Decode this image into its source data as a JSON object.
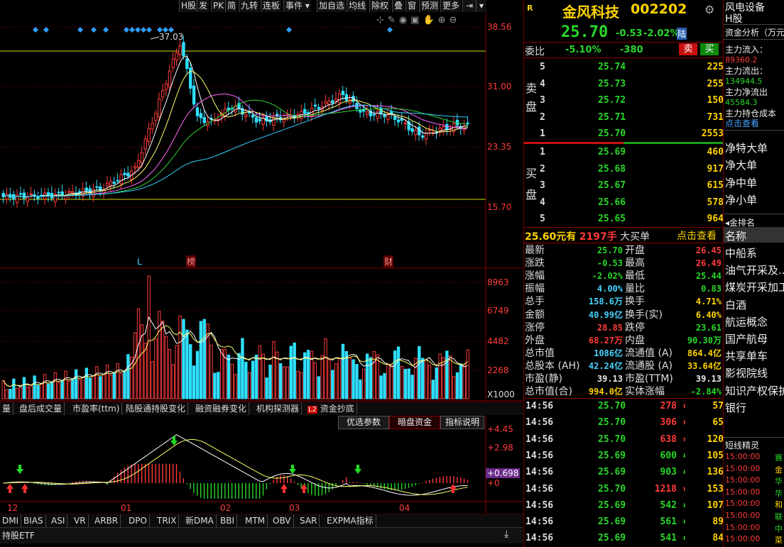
{
  "toolbar": {
    "left_buttons": [
      "H股",
      "发",
      "PK",
      "简",
      "九转",
      "连板",
      "事件"
    ],
    "right_buttons": [
      "加自选",
      "均线",
      "除权",
      "叠",
      "窗",
      "预测",
      "更多"
    ]
  },
  "price_axis": [
    "38.56",
    "31.00",
    "23.35",
    "15.70"
  ],
  "high_marker": "37.03",
  "event_markers": [
    "L",
    "榜",
    "财"
  ],
  "volume_axis": [
    "8963",
    "6749",
    "4482",
    "2268",
    "X1000"
  ],
  "indicator_tabs": [
    "量",
    "盘后成交量",
    "市盈率(ttm)",
    "陆股通持股变化",
    "融资融券变化",
    "机构探测器",
    "资金抄底"
  ],
  "indicator_tab_l2_badge": "L2",
  "indicator_buttons": [
    "优选参数",
    "暗盘资金",
    "指标说明"
  ],
  "macd_axis": [
    "+4.45",
    "+2.98",
    "+0.698",
    "+0"
  ],
  "date_axis": [
    "12",
    "01",
    "02",
    "03",
    "04"
  ],
  "bottom_tabs": [
    "DMI",
    "BIAS",
    "ASI",
    "VR",
    "ARBR",
    "DPO",
    "TRIX",
    "新DMA",
    "BBI",
    "MTM",
    "OBV",
    "SAR",
    "EXPMA指标"
  ],
  "bottom_label": "持股ETF",
  "quote": {
    "r_badge": "R",
    "name": "金风科技",
    "code": "002202",
    "price": "25.70",
    "change": "-0.53",
    "change_pct": "-2.02%",
    "lu_badge": "陆",
    "weibi_label": "委比",
    "weibi_pct": "-5.10%",
    "weicha": "-380",
    "buy_btn": "买",
    "sell_btn": "卖",
    "sell_label": "卖盘",
    "buy_label": "买盘",
    "asks": [
      {
        "level": "5",
        "price": "25.74",
        "vol": "225"
      },
      {
        "level": "4",
        "price": "25.73",
        "vol": "255"
      },
      {
        "level": "3",
        "price": "25.72",
        "vol": "150"
      },
      {
        "level": "2",
        "price": "25.71",
        "vol": "731"
      },
      {
        "level": "1",
        "price": "25.70",
        "vol": "2553"
      }
    ],
    "bids": [
      {
        "level": "1",
        "price": "25.69",
        "vol": "460"
      },
      {
        "level": "2",
        "price": "25.68",
        "vol": "917"
      },
      {
        "level": "3",
        "price": "25.67",
        "vol": "615"
      },
      {
        "level": "4",
        "price": "25.66",
        "vol": "578"
      },
      {
        "level": "5",
        "price": "25.65",
        "vol": "964"
      }
    ],
    "big_order_price": "25.60元有",
    "big_order_vol": "2197手",
    "big_order_label": "大买单",
    "big_order_link": "点击查看",
    "stats": [
      {
        "l1": "最新",
        "v1": "25.70",
        "c1": "grn",
        "l2": "开盘",
        "v2": "26.45",
        "c2": "red"
      },
      {
        "l1": "涨跌",
        "v1": "-0.53",
        "c1": "grn",
        "l2": "最高",
        "v2": "26.49",
        "c2": "red"
      },
      {
        "l1": "涨幅",
        "v1": "-2.02%",
        "c1": "grn",
        "l2": "最低",
        "v2": "25.44",
        "c2": "grn"
      },
      {
        "l1": "振幅",
        "v1": "4.00%",
        "c1": "cyan",
        "l2": "量比",
        "v2": "0.83",
        "c2": "grn"
      },
      {
        "l1": "总手",
        "v1": "158.6万",
        "c1": "cyan",
        "l2": "换手",
        "v2": "4.71%",
        "c2": "yel"
      },
      {
        "l1": "金额",
        "v1": "40.99亿",
        "c1": "cyan",
        "l2": "换手(实)",
        "v2": "6.40%",
        "c2": "yel"
      },
      {
        "l1": "涨停",
        "v1": "28.85",
        "c1": "red",
        "l2": "跌停",
        "v2": "23.61",
        "c2": "grn"
      },
      {
        "l1": "外盘",
        "v1": "68.27万",
        "c1": "red",
        "l2": "内盘",
        "v2": "90.30万",
        "c2": "grn"
      },
      {
        "l1": "总市值",
        "v1": "1086亿",
        "c1": "cyan",
        "l2": "流通值 (A)",
        "v2": "864.4亿",
        "c2": "yel"
      },
      {
        "l1": "总股本 (AH)",
        "v1": "42.24亿",
        "c1": "cyan",
        "l2": "流通股 (A)",
        "v2": "33.64亿",
        "c2": "yel"
      },
      {
        "l1": "市盈(静)",
        "v1": "39.13",
        "c1": "wht",
        "l2": "市盈(TTM)",
        "v2": "39.13",
        "c2": "wht"
      },
      {
        "l1": "总市值(合)",
        "v1": "994.0亿",
        "c1": "yel",
        "l2": "实体涨幅",
        "v2": "-2.84%",
        "c2": "grn"
      }
    ],
    "ticks": [
      {
        "t": "14:56",
        "p": "25.70",
        "pc": "grn",
        "v": "278",
        "vc": "red",
        "dir": "up",
        "n": "57"
      },
      {
        "t": "14:56",
        "p": "25.70",
        "pc": "grn",
        "v": "306",
        "vc": "red",
        "dir": "up",
        "n": "65"
      },
      {
        "t": "14:56",
        "p": "25.70",
        "pc": "grn",
        "v": "638",
        "vc": "red",
        "dir": "up",
        "n": "120"
      },
      {
        "t": "14:56",
        "p": "25.69",
        "pc": "grn",
        "v": "600",
        "vc": "grn",
        "dir": "down",
        "n": "105"
      },
      {
        "t": "14:56",
        "p": "25.69",
        "pc": "grn",
        "v": "903",
        "vc": "grn",
        "dir": "down",
        "n": "136"
      },
      {
        "t": "14:56",
        "p": "25.70",
        "pc": "grn",
        "v": "1218",
        "vc": "red",
        "dir": "up",
        "n": "153"
      },
      {
        "t": "14:56",
        "p": "25.69",
        "pc": "grn",
        "v": "542",
        "vc": "grn",
        "dir": "down",
        "n": "107"
      },
      {
        "t": "14:56",
        "p": "25.69",
        "pc": "grn",
        "v": "561",
        "vc": "grn",
        "dir": "down",
        "n": "89"
      },
      {
        "t": "14:56",
        "p": "25.69",
        "pc": "grn",
        "v": "541",
        "vc": "grn",
        "dir": "down",
        "n": "84"
      }
    ]
  },
  "side": {
    "industry": "风电设备",
    "h_share": "H股",
    "fund_title": "资金分析（万元",
    "inflow_label": "主力流入：",
    "inflow_val": "89360.2",
    "outflow_label": "主力流出：",
    "outflow_val": "134944.5",
    "net_label": "主力净流出",
    "net_val": "45584.3",
    "cost_label": "主力持仓成本",
    "cost_link": "点击查看",
    "flows": [
      "净特大单",
      "净大单",
      "净中单",
      "净小单"
    ],
    "rank_title": "金排名",
    "rank_header": "名称",
    "concepts": [
      "中船系",
      "油气开采及...",
      "煤炭开采加工",
      "白酒",
      "航运概念",
      "国产航母",
      "共享单车",
      "影视院线",
      "知识产权保护",
      "银行"
    ],
    "short_title": "短线精灵",
    "short_times": [
      "15:00:00",
      "15:00:00",
      "15:00:00",
      "15:00:00",
      "15:00:00",
      "15:00:00",
      "15:00:00",
      "15:00:00"
    ],
    "short_names": [
      "赛",
      "金",
      "华",
      "华",
      "和",
      "联",
      "中",
      "菜"
    ]
  },
  "colors": {
    "up": "#ff3b3b",
    "down": "#2ee0ff",
    "green": "#28d828",
    "ma5": "#ffffff",
    "ma10": "#ffff66",
    "ma20": "#ff66ff",
    "ma30": "#33cc33",
    "ma60": "#33ccff"
  }
}
